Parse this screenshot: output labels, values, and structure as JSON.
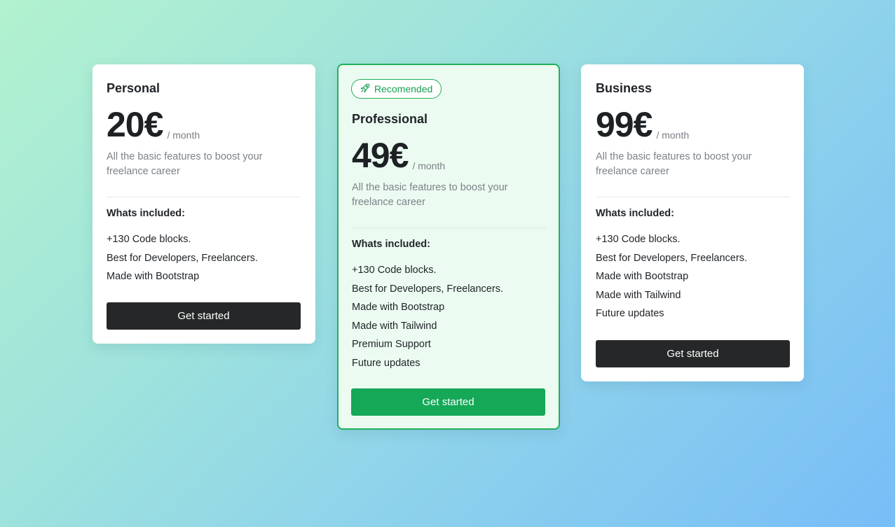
{
  "colors": {
    "accent_green": "#14a857",
    "badge_green": "#17a052",
    "dark_button": "#262728"
  },
  "plans": [
    {
      "name": "Personal",
      "price": "20€",
      "period": "/ month",
      "description": "All the basic features to boost your freelance career",
      "included_title": "Whats included:",
      "features": [
        "+130 Code blocks.",
        "Best for Developers, Freelancers.",
        "Made with Bootstrap"
      ],
      "button_label": "Get started"
    },
    {
      "badge": "Recomended",
      "badge_icon": "rocket-icon",
      "name": "Professional",
      "price": "49€",
      "period": "/ month",
      "description": "All the basic features to boost your freelance career",
      "included_title": "Whats included:",
      "features": [
        "+130 Code blocks.",
        "Best for Developers, Freelancers.",
        "Made with Bootstrap",
        "Made with Tailwind",
        "Premium Support",
        "Future updates"
      ],
      "button_label": "Get started"
    },
    {
      "name": "Business",
      "price": "99€",
      "period": "/ month",
      "description": "All the basic features to boost your freelance career",
      "included_title": "Whats included:",
      "features": [
        "+130 Code blocks.",
        "Best for Developers, Freelancers.",
        "Made with Bootstrap",
        "Made with Tailwind",
        "Future updates"
      ],
      "button_label": "Get started"
    }
  ]
}
